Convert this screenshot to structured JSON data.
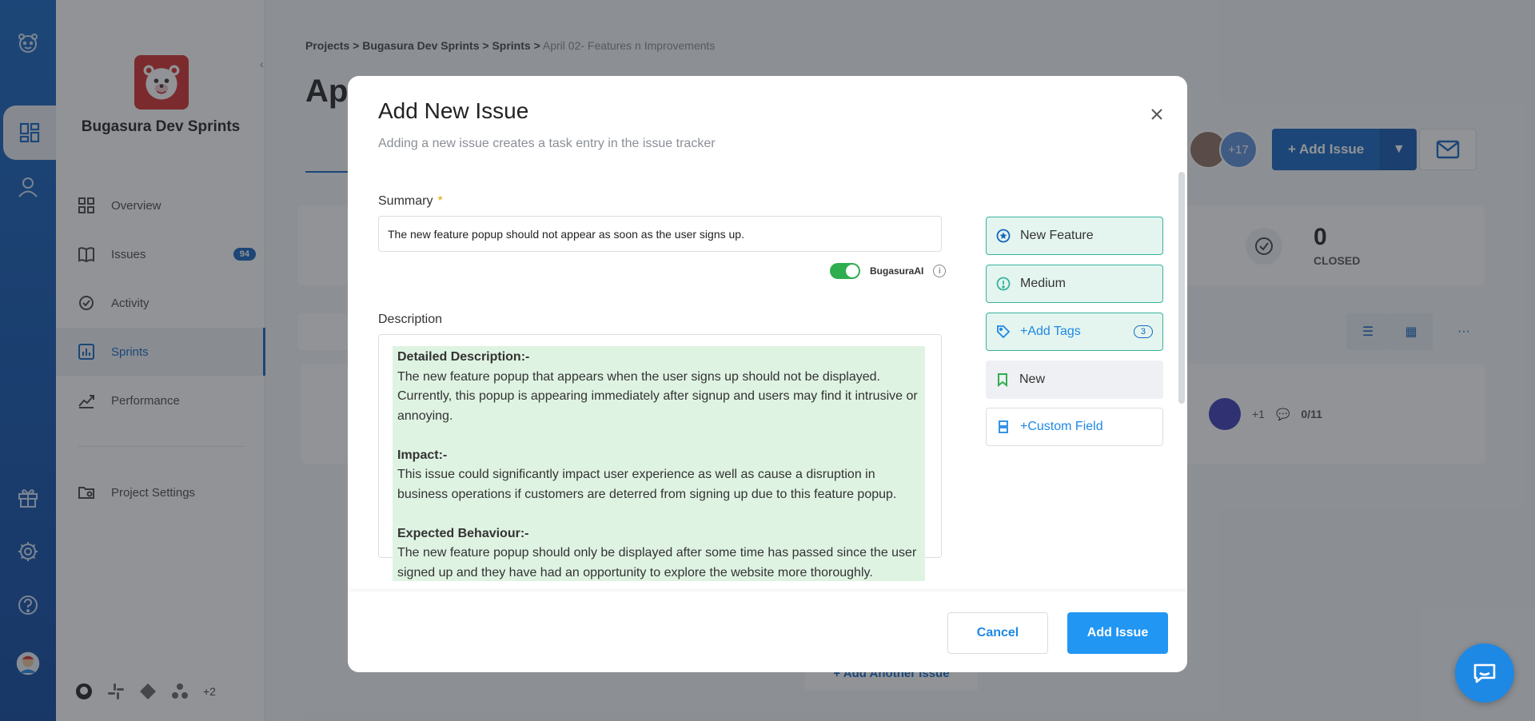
{
  "colors": {
    "accent": "#1565c0",
    "primary_button": "#2196f3",
    "highlight": "#dff3e2",
    "success": "#2eae4f",
    "prop_border": "#36b39a"
  },
  "rail": {
    "icons": [
      "bear-logo-icon",
      "dashboard-icon",
      "user-icon",
      "gift-icon",
      "gear-icon",
      "help-icon",
      "avatar"
    ]
  },
  "sidebar": {
    "project_name": "Bugasura Dev Sprints",
    "items": [
      {
        "label": "Overview",
        "icon": "grid-icon"
      },
      {
        "label": "Issues",
        "icon": "book-icon",
        "badge": "94"
      },
      {
        "label": "Activity",
        "icon": "activity-icon"
      },
      {
        "label": "Sprints",
        "icon": "chart-icon",
        "active": true
      },
      {
        "label": "Performance",
        "icon": "trend-icon"
      },
      {
        "label": "Project Settings",
        "icon": "settings-folder-icon"
      }
    ],
    "integrations_more": "+2"
  },
  "background": {
    "breadcrumb": {
      "projects": "Projects",
      "project": "Bugasura Dev Sprints",
      "sprints": "Sprints",
      "current": "April 02- Features n Improvements",
      "sep": ">"
    },
    "page_title": "Apr",
    "avatars_more": "+17",
    "add_issue_label": "+ Add Issue",
    "closed_count": "0",
    "closed_label": "CLOSED",
    "row_plus": "+1",
    "row_comments": "0/11",
    "add_another_label": "+ Add Another Issue"
  },
  "modal": {
    "title": "Add New Issue",
    "subtitle": "Adding a new issue creates a task entry in the issue tracker",
    "summary_label": "Summary",
    "summary_required": "*",
    "summary_value": "The new feature popup should not appear as soon as the user signs up.",
    "ai_label": "BugasuraAI",
    "ai_enabled": true,
    "description_label": "Description",
    "description": {
      "h1": "Detailed Description:-",
      "p1": "The new feature popup that appears when the user signs up should not be displayed. Currently, this popup is appearing immediately after signup and users may find it intrusive or annoying.",
      "h2": "Impact:-",
      "p2": "This issue could significantly impact user experience as well as cause a disruption in business operations if customers are deterred from signing up due to this feature popup.",
      "h3": "Expected Behaviour:-",
      "p3": "The new feature popup should only be displayed after some time has passed since the user signed up and they have had an opportunity to explore the website more thoroughly."
    },
    "properties": {
      "type": "New Feature",
      "severity": "Medium",
      "tags_label": "+Add Tags",
      "tags_count": "3",
      "status": "New",
      "custom_field": "+Custom Field"
    },
    "cancel_label": "Cancel",
    "add_label": "Add Issue"
  }
}
